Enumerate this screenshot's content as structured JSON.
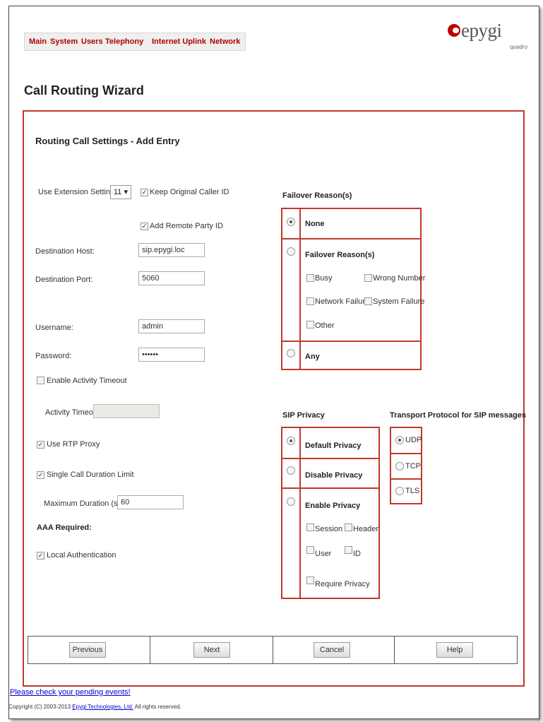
{
  "nav": {
    "items": [
      "Main",
      "System",
      "Users",
      "Telephony",
      "Internet Uplink",
      "Network"
    ]
  },
  "logo": {
    "word": "epygi",
    "sub": "quadro"
  },
  "page_title": "Call Routing Wizard",
  "section_title": "Routing Call Settings - Add Entry",
  "form": {
    "use_ext_label": "Use Extension Settings:",
    "use_ext_value": "11",
    "keep_caller_id": "Keep Original Caller ID",
    "add_remote_party": "Add Remote Party ID",
    "dest_host_label": "Destination Host:",
    "dest_host_value": "sip.epygi.loc",
    "dest_port_label": "Destination Port:",
    "dest_port_value": "5060",
    "username_label": "Username:",
    "username_value": "admin",
    "password_label": "Password:",
    "password_value": "••••••",
    "enable_activity": "Enable Activity Timeout",
    "activity_timeout_label": "Activity Timeout:",
    "activity_timeout_value": "",
    "use_rtp_proxy": "Use RTP Proxy",
    "single_call_limit": "Single Call Duration Limit",
    "max_duration_label": "Maximum Duration (sec):",
    "max_duration_value": "60",
    "aaa_required": "AAA Required:",
    "local_auth": "Local Authentication"
  },
  "failover": {
    "heading": "Failover Reason(s)",
    "none": "None",
    "reasons_label": "Failover Reason(s)",
    "busy": "Busy",
    "wrong_number": "Wrong Number",
    "network_failure": "Network Failure",
    "system_failure": "System Failure",
    "other": "Other",
    "any": "Any"
  },
  "sip_privacy": {
    "heading": "SIP Privacy",
    "default": "Default Privacy",
    "disable": "Disable Privacy",
    "enable": "Enable Privacy",
    "session": "Session",
    "header": "Header",
    "user": "User",
    "id": "ID",
    "require": "Require Privacy"
  },
  "transport": {
    "heading": "Transport Protocol for SIP messages",
    "udp": "UDP",
    "tcp": "TCP",
    "tls": "TLS"
  },
  "buttons": {
    "previous": "Previous",
    "next": "Next",
    "cancel": "Cancel",
    "help": "Help"
  },
  "footer": {
    "pending": "Please check your pending events!",
    "copy_prefix": "Copyright (C) 2003-2013",
    "company": "Epygi Technologies, Ltd.",
    "copy_suffix": "All rights reserved."
  },
  "colors": {
    "accent": "#c0392b",
    "nav_text": "#b00000",
    "link": "#0000cc"
  }
}
